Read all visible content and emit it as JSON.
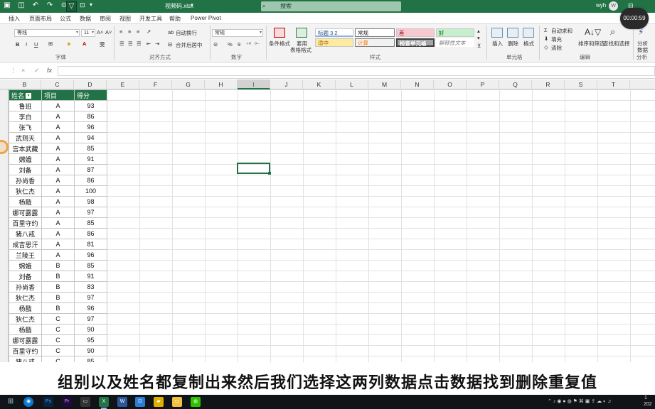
{
  "titlebar": {
    "filename": "视频码.xlsx",
    "search_placeholder": "搜索",
    "user": "wyh",
    "user_initial": "W",
    "recording_time": "00:00:59"
  },
  "menu": {
    "tabs": [
      "插入",
      "页面布局",
      "公式",
      "数据",
      "审阅",
      "视图",
      "开发工具",
      "帮助",
      "Power Pivot"
    ]
  },
  "ribbon": {
    "font_name": "等线",
    "font_size": "11",
    "bold": "B",
    "italic": "I",
    "underline": "U",
    "wrap_text": "自动换行",
    "merge_center": "合并后居中",
    "number_format": "常规",
    "percent": "%",
    "comma": "9",
    "conditional_format": "条件格式",
    "format_as_table_1": "套用",
    "format_as_table_2": "表格格式",
    "styles": {
      "heading3": "标题 3 2",
      "normal": "常规",
      "bad": "差",
      "good": "好",
      "neutral": "适中",
      "calculation": "计算",
      "check_cell": "检查单元格",
      "explanatory": "解释性文本"
    },
    "insert": "插入",
    "delete": "删除",
    "format": "格式",
    "autosum": "自动求和",
    "fill": "填充",
    "clear": "清除",
    "sort_filter": "排序和筛选",
    "find_select": "查找和选择",
    "analyze_data_1": "分析",
    "analyze_data_2": "数据",
    "groups": {
      "font": "字体",
      "alignment": "对齐方式",
      "number": "数字",
      "styles": "样式",
      "cells": "单元格",
      "editing": "编辑",
      "analysis": "分析"
    }
  },
  "formula_bar": {
    "cancel": "×",
    "enter": "✓",
    "fx": "fx"
  },
  "columns": [
    "B",
    "C",
    "D",
    "E",
    "F",
    "G",
    "H",
    "I",
    "J",
    "K",
    "L",
    "M",
    "N",
    "O",
    "P",
    "Q",
    "R",
    "S",
    "T"
  ],
  "selected_column": "I",
  "table": {
    "headers": [
      "姓名",
      "项目",
      "得分"
    ],
    "rows": [
      [
        "鲁班",
        "A",
        "93"
      ],
      [
        "李白",
        "A",
        "86"
      ],
      [
        "张飞",
        "A",
        "96"
      ],
      [
        "武则天",
        "A",
        "94"
      ],
      [
        "宫本武藏",
        "A",
        "85"
      ],
      [
        "嫦娥",
        "A",
        "91"
      ],
      [
        "刘备",
        "A",
        "87"
      ],
      [
        "孙尚香",
        "A",
        "86"
      ],
      [
        "狄仁杰",
        "A",
        "100"
      ],
      [
        "杨戬",
        "A",
        "98"
      ],
      [
        "娜可露露",
        "A",
        "97"
      ],
      [
        "百里守约",
        "A",
        "85"
      ],
      [
        "猪八戒",
        "A",
        "86"
      ],
      [
        "成吉思汗",
        "A",
        "81"
      ],
      [
        "兰陵王",
        "A",
        "96"
      ],
      [
        "嫦娥",
        "B",
        "85"
      ],
      [
        "刘备",
        "B",
        "91"
      ],
      [
        "孙尚香",
        "B",
        "83"
      ],
      [
        "狄仁杰",
        "B",
        "97"
      ],
      [
        "杨戬",
        "B",
        "96"
      ],
      [
        "狄仁杰",
        "C",
        "97"
      ],
      [
        "杨戬",
        "C",
        "90"
      ],
      [
        "娜可露露",
        "C",
        "95"
      ],
      [
        "百里守约",
        "C",
        "90"
      ],
      [
        "猪八戒",
        "C",
        "85"
      ]
    ]
  },
  "subtitle": "组别以及姓名都复制出来然后我们选择这两列数据点击数据找到删除重复值",
  "taskbar": {
    "clock_line1": "1",
    "clock_line2": "202"
  },
  "colors": {
    "excel_green": "#217346",
    "taskbar": "#101418"
  }
}
